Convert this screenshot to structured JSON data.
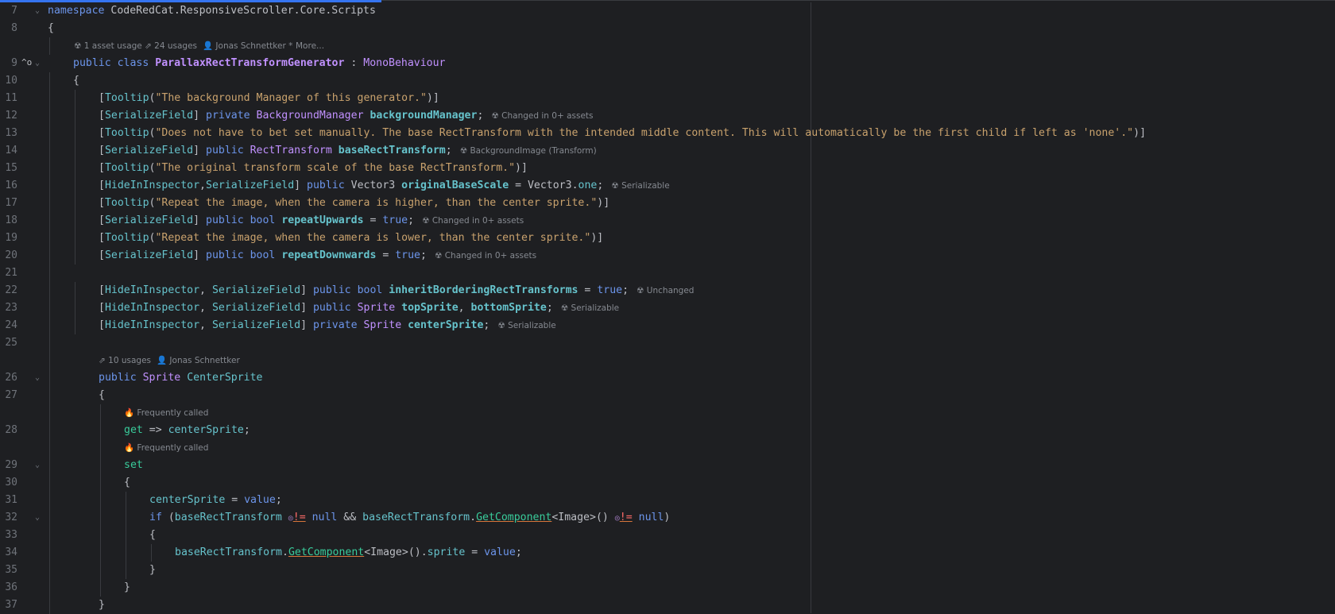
{
  "lines": {
    "l7": {
      "num": "7",
      "kw": "namespace",
      "ns": "CodeRedCat.ResponsiveScroller.Core.Scripts"
    },
    "l8": {
      "num": "8",
      "text": "{"
    },
    "hint_class": {
      "asset": "1 asset usage",
      "usages": "24 usages",
      "author": "Jonas Schnettker *",
      "more": "More..."
    },
    "l9": {
      "num": "9",
      "public": "public",
      "class": "class",
      "name": "ParallaxRectTransformGenerator",
      "colon": " : ",
      "base": "MonoBehaviour"
    },
    "l10": {
      "num": "10",
      "text": "{"
    },
    "l11": {
      "num": "11",
      "attr": "Tooltip",
      "str": "\"The background Manager of this generator.\""
    },
    "l12": {
      "num": "12",
      "attr": "SerializeField",
      "mod": "private",
      "type": "BackgroundManager",
      "field": "backgroundManager",
      "hint": "Changed in 0+ assets"
    },
    "l13": {
      "num": "13",
      "attr": "Tooltip",
      "str": "\"Does not have to bet set manually. The base RectTransform with the intended middle content. This will automatically be the first child if left as 'none'.\""
    },
    "l14": {
      "num": "14",
      "attr": "SerializeField",
      "mod": "public",
      "type": "RectTransform",
      "field": "baseRectTransform",
      "hint": "BackgroundImage (Transform)"
    },
    "l15": {
      "num": "15",
      "attr": "Tooltip",
      "str": "\"The original transform scale of the base RectTransform.\""
    },
    "l16": {
      "num": "16",
      "attr1": "HideInInspector",
      "attr2": "SerializeField",
      "mod": "public",
      "type": "Vector3",
      "field": "originalBaseScale",
      "val1": "Vector3",
      "val2": "one",
      "hint": "Serializable"
    },
    "l17": {
      "num": "17",
      "attr": "Tooltip",
      "str": "\"Repeat the image, when the camera is higher, than the center sprite.\""
    },
    "l18": {
      "num": "18",
      "attr": "SerializeField",
      "mod": "public",
      "type": "bool",
      "field": "repeatUpwards",
      "val": "true",
      "hint": "Changed in 0+ assets"
    },
    "l19": {
      "num": "19",
      "attr": "Tooltip",
      "str": "\"Repeat the image, when the camera is lower, than the center sprite.\""
    },
    "l20": {
      "num": "20",
      "attr": "SerializeField",
      "mod": "public",
      "type": "bool",
      "field": "repeatDownwards",
      "val": "true",
      "hint": "Changed in 0+ assets"
    },
    "l21": {
      "num": "21"
    },
    "l22": {
      "num": "22",
      "attr1": "HideInInspector",
      "attr2": "SerializeField",
      "mod": "public",
      "type": "bool",
      "field": "inheritBorderingRectTransforms",
      "val": "true",
      "hint": "Unchanged"
    },
    "l23": {
      "num": "23",
      "attr1": "HideInInspector",
      "attr2": "SerializeField",
      "mod": "public",
      "type": "Sprite",
      "field": "topSprite",
      "field2": "bottomSprite",
      "hint": "Serializable"
    },
    "l24": {
      "num": "24",
      "attr1": "HideInInspector",
      "attr2": "SerializeField",
      "mod": "private",
      "type": "Sprite",
      "field": "centerSprite",
      "hint": "Serializable"
    },
    "l25": {
      "num": "25"
    },
    "hint_prop": {
      "usages": "10 usages",
      "author": "Jonas Schnettker"
    },
    "l26": {
      "num": "26",
      "mod": "public",
      "type": "Sprite",
      "name": "CenterSprite"
    },
    "l27": {
      "num": "27",
      "text": "{"
    },
    "hint_get": "Frequently called",
    "l28": {
      "num": "28",
      "kw": "get",
      "arrow": " => ",
      "field": "centerSprite"
    },
    "hint_set": "Frequently called",
    "l29": {
      "num": "29",
      "kw": "set"
    },
    "l30": {
      "num": "30",
      "text": "{"
    },
    "l31": {
      "num": "31",
      "field": "centerSprite",
      "eq": " = ",
      "val": "value"
    },
    "l32": {
      "num": "32",
      "kw": "if",
      "field": "baseRectTransform",
      "neq": "!=",
      "null": "null",
      "and": " && ",
      "method": "GetComponent",
      "generic": "Image"
    },
    "l33": {
      "num": "33",
      "text": "{"
    },
    "l34": {
      "num": "34",
      "field": "baseRectTransform",
      "method": "GetComponent",
      "generic": "Image",
      "prop": "sprite",
      "val": "value"
    },
    "l35": {
      "num": "35",
      "text": "}"
    },
    "l36": {
      "num": "36",
      "text": "}"
    },
    "l37": {
      "num": "37",
      "text": "}"
    }
  },
  "colors": {
    "accent": "#3574f0",
    "background": "#1e1f22"
  }
}
